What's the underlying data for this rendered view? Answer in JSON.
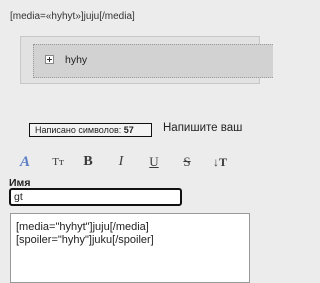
{
  "preview": {
    "media_line": "[media=«hyhyt»]juju[/media]",
    "spoiler_title": "hyhy"
  },
  "counter": {
    "label": "Написано символов:",
    "value": "57"
  },
  "hint": "Напишите ваш",
  "toolbar": {
    "font_color": "A",
    "font_face": "Tт",
    "bold": "B",
    "italic": "I",
    "underline": "U",
    "strike": "S",
    "size": "↓T"
  },
  "name_field": {
    "label": "Имя",
    "value": "gt"
  },
  "editor": {
    "lines": [
      "[media=\"hyhyt\"]juju[/media]",
      "[spoiler=\"hyhy\"]juku[/spoiler]"
    ]
  }
}
